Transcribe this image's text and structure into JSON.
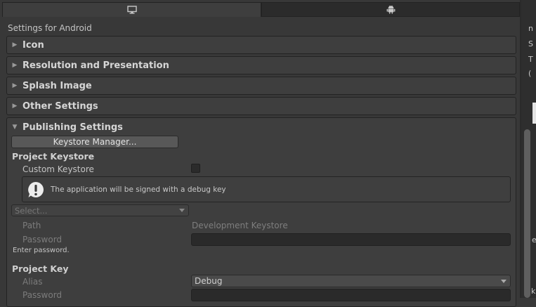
{
  "platform_tabs": [
    {
      "icon": "monitor-icon",
      "selected": false
    },
    {
      "icon": "android-icon",
      "selected": true
    }
  ],
  "page_title": "Settings for Android",
  "foldouts": [
    {
      "label": "Icon",
      "expanded": false
    },
    {
      "label": "Resolution and Presentation",
      "expanded": false
    },
    {
      "label": "Splash Image",
      "expanded": false
    },
    {
      "label": "Other Settings",
      "expanded": false
    }
  ],
  "publishing": {
    "label": "Publishing Settings",
    "expanded": true,
    "keystore_manager_button": "Keystore Manager...",
    "project_keystore": {
      "heading": "Project Keystore",
      "custom_keystore_label": "Custom Keystore",
      "custom_keystore_checked": false,
      "help_text": "The application will be signed with a debug key",
      "select_placeholder": "Select...",
      "path_label": "Path",
      "path_value": "Development Keystore",
      "password_label": "Password",
      "password_value": "",
      "password_hint": "Enter password."
    },
    "project_key": {
      "heading": "Project Key",
      "alias_label": "Alias",
      "alias_value": "Debug",
      "password_label": "Password",
      "password_value": ""
    }
  },
  "colors": {
    "background": "#383838",
    "panel": "#3e3e3e",
    "border": "#232323",
    "text": "#c4c4c4",
    "field": "#2a2a2a",
    "button": "#585858"
  }
}
